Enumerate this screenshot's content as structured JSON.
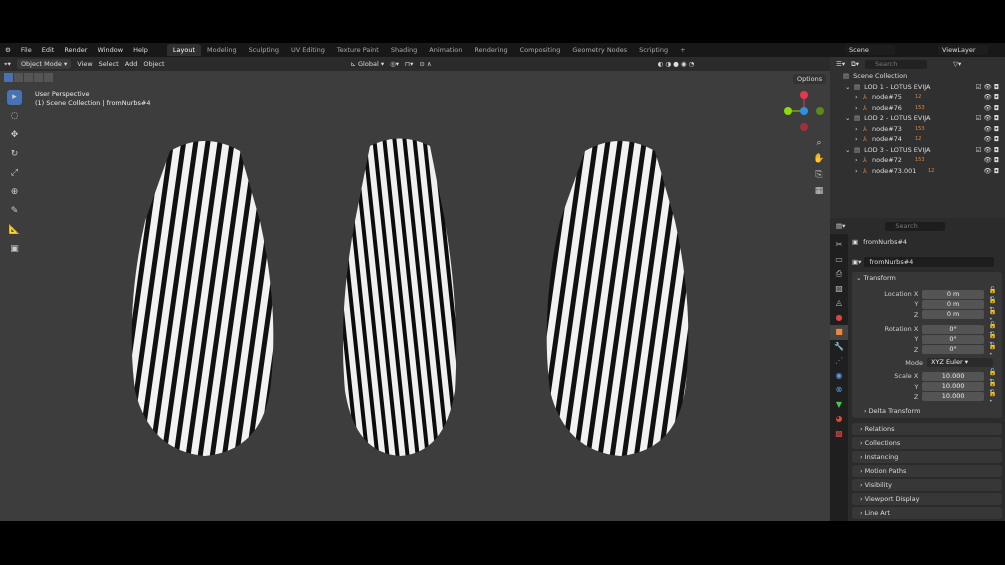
{
  "menu": [
    "File",
    "Edit",
    "Render",
    "Window",
    "Help"
  ],
  "workspaces": [
    "Layout",
    "Modeling",
    "Sculpting",
    "UV Editing",
    "Texture Paint",
    "Shading",
    "Animation",
    "Rendering",
    "Compositing",
    "Geometry Nodes",
    "Scripting"
  ],
  "active_workspace": "Layout",
  "scene": "Scene",
  "view_layer": "ViewLayer",
  "header": {
    "mode": "Object Mode",
    "view": "View",
    "select": "Select",
    "add": "Add",
    "object": "Object",
    "orientation": "Global",
    "options": "Options"
  },
  "viewport": {
    "line1": "User Perspective",
    "line2": "(1) Scene Collection | fromNurbs#4"
  },
  "outliner": {
    "search_placeholder": "Search",
    "root": "Scene Collection",
    "collections": [
      {
        "name": "LOD 1 - LOTUS EVIJA",
        "children": [
          {
            "name": "node#75",
            "badge": "12"
          },
          {
            "name": "node#76",
            "badge": "153"
          }
        ]
      },
      {
        "name": "LOD 2 - LOTUS EVIJA",
        "children": [
          {
            "name": "node#73",
            "badge": "153"
          },
          {
            "name": "node#74",
            "badge": "12"
          }
        ]
      },
      {
        "name": "LOD 3 - LOTUS EVIJA",
        "children": [
          {
            "name": "node#72",
            "badge": "153"
          },
          {
            "name": "node#73.001",
            "badge": "12"
          }
        ]
      }
    ]
  },
  "properties": {
    "search_placeholder": "Search",
    "object_name": "fromNurbs#4",
    "data_name": "fromNurbs#4",
    "transform": "Transform",
    "location_label": "Location X",
    "rotation_label": "Rotation X",
    "mode_label": "Mode",
    "scale_label": "Scale X",
    "y": "Y",
    "z": "Z",
    "location": [
      "0 m",
      "0 m",
      "0 m"
    ],
    "rotation": [
      "0°",
      "0°",
      "0°"
    ],
    "mode": "XYZ Euler",
    "scale": [
      "10.000",
      "10.000",
      "10.000"
    ],
    "delta": "Delta Transform",
    "panels": [
      "Relations",
      "Collections",
      "Instancing",
      "Motion Paths",
      "Visibility",
      "Viewport Display",
      "Line Art"
    ]
  },
  "colors": {
    "accent": "#4772b3",
    "object_orange": "#e8883a",
    "x_axis": "#e3384d",
    "y_axis": "#8bdc00",
    "z_axis": "#2e8fe6"
  }
}
